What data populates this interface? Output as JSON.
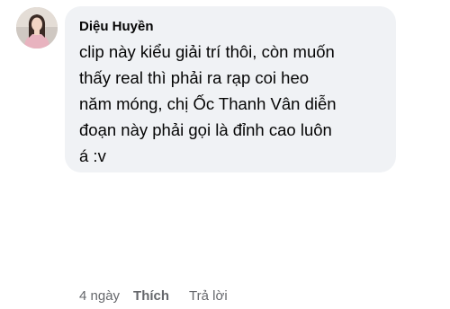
{
  "comment": {
    "author": "Diệu Huyền",
    "text": "clip này kiểu giải trí thôi, còn muốn\nthấy real thì phải ra rạp coi heo\nnăm móng, chị Ốc Thanh Vân diễn\nđoạn này phải gọi là đỉnh cao luôn\ná :v",
    "timestamp": "4 ngày",
    "like_label": "Thích",
    "reply_label": "Trả lời"
  },
  "colors": {
    "bubble_background": "#f0f2f5",
    "text": "#050505",
    "secondary_text": "#65676b"
  }
}
